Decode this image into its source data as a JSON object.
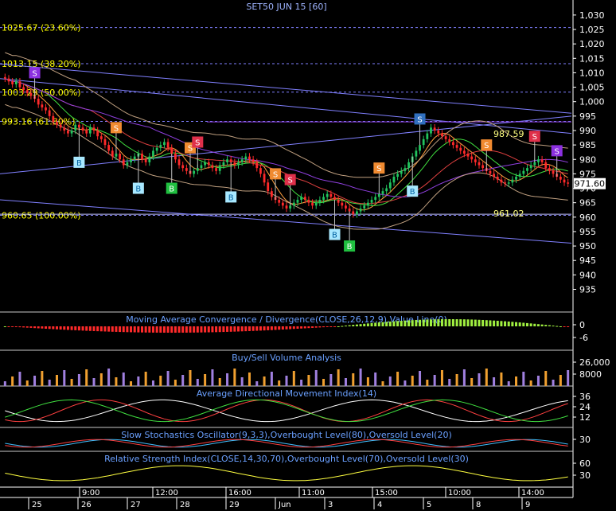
{
  "title": "SET50 JUN 15   [60]",
  "colors": {
    "background": "#000000",
    "bull": "#22c55e",
    "bear": "#ff2a2a",
    "axis_text": "#ffffff",
    "panel_title": "#6aa0ff",
    "fib": "#8080ff",
    "fib_label": "#ffff00",
    "price_box": "#ffffff",
    "sell_orange": "#f08a30",
    "sell_red": "#e0304a",
    "sell_purple": "#8c30e0",
    "buy_cyan": "#a8e8ff",
    "buy_green": "#20c040"
  },
  "price_axis": {
    "ticks": [
      "1,030",
      "1,025",
      "1,020",
      "1,015",
      "1,010",
      "1,005",
      "1,000",
      "995",
      "990",
      "985",
      "980",
      "975",
      "970",
      "965",
      "960",
      "955",
      "950",
      "945",
      "940",
      "935"
    ],
    "current_price": "971.60"
  },
  "fib_levels": [
    {
      "label": "1025.67 (23.60%)",
      "value": 1025.67
    },
    {
      "label": "1013.15 (38.20%)",
      "value": 1013.15
    },
    {
      "label": "1003.29 (50.00%)",
      "value": 1003.29
    },
    {
      "label": "993.16 (61.80%)",
      "value": 993.16
    },
    {
      "label": "960.65 (100.00%)",
      "value": 960.65
    }
  ],
  "annotations": [
    {
      "text": "987.59",
      "value": 987.59
    },
    {
      "text": "961.02",
      "value": 961.02
    }
  ],
  "signals": [
    {
      "type": "S",
      "style": "sell_purple",
      "bar": 8
    },
    {
      "type": "S",
      "style": "sell_orange",
      "bar": 30
    },
    {
      "type": "S",
      "style": "sell_orange",
      "bar": 50
    },
    {
      "type": "S",
      "style": "sell_red",
      "bar": 52
    },
    {
      "type": "S",
      "style": "sell_orange",
      "bar": 73
    },
    {
      "type": "S",
      "style": "sell_red",
      "bar": 77
    },
    {
      "type": "S",
      "style": "sell_orange",
      "bar": 101
    },
    {
      "type": "S",
      "style": "sell_orange",
      "bar": 130
    },
    {
      "type": "S",
      "style": "sell_red",
      "bar": 143
    },
    {
      "type": "S",
      "style": "sell_purple",
      "bar": 149
    },
    {
      "type": "B",
      "style": "buy_cyan",
      "bar": 20
    },
    {
      "type": "B",
      "style": "buy_cyan",
      "bar": 36
    },
    {
      "type": "B",
      "style": "buy_green",
      "bar": 45
    },
    {
      "type": "B",
      "style": "buy_cyan",
      "bar": 61
    },
    {
      "type": "B",
      "style": "buy_cyan",
      "bar": 89
    },
    {
      "type": "B",
      "style": "buy_green",
      "bar": 93
    },
    {
      "type": "B",
      "style": "buy_cyan",
      "bar": 110
    },
    {
      "type": "S",
      "style": "sell_blue",
      "bar": 112
    }
  ],
  "panels": [
    {
      "title": "Moving Average Convergence / Divergence(CLOSE,26,12,9),Value Line(0)",
      "ticks": [
        "0",
        "-6"
      ]
    },
    {
      "title": "Buy/Sell Volume Analysis",
      "ticks": [
        "26,000",
        "8000"
      ]
    },
    {
      "title": "Average Directional Movement Index(14)",
      "ticks": [
        "36",
        "24",
        "12"
      ]
    },
    {
      "title": "Slow Stochastics Oscillator(9,3,3),Overbought Level(80),Oversold Level(20)",
      "ticks": [
        "30"
      ]
    },
    {
      "title": "Relative Strength Index(CLOSE,14,30,70),Overbought Level(70),Oversold Level(30)",
      "ticks": [
        "60",
        "30"
      ]
    }
  ],
  "time_axis": {
    "times": [
      "9:00",
      "12:00",
      "16:00",
      "11:00",
      "15:00",
      "10:00",
      "14:00"
    ],
    "dates": [
      "25",
      "26",
      "27",
      "28",
      "29",
      "Jun",
      "3",
      "4",
      "5",
      "8",
      "9"
    ]
  },
  "chart_data": {
    "type": "candlestick",
    "title": "SET50 JUN 15   [60]",
    "ylim": [
      931,
      1033
    ],
    "close": [
      1008,
      1007,
      1006,
      1007,
      1005,
      1004,
      1003,
      1002,
      1001,
      999,
      998,
      997,
      995,
      993,
      992,
      991,
      990,
      989,
      990,
      992,
      991,
      990,
      989,
      991,
      990,
      988,
      987,
      985,
      983,
      981,
      982,
      980,
      978,
      979,
      980,
      981,
      982,
      980,
      979,
      981,
      983,
      984,
      985,
      986,
      984,
      982,
      980,
      978,
      977,
      976,
      975,
      976,
      977,
      978,
      979,
      978,
      977,
      976,
      978,
      979,
      980,
      979,
      978,
      979,
      980,
      981,
      980,
      979,
      977,
      975,
      972,
      969,
      967,
      966,
      965,
      964,
      963,
      964,
      965,
      966,
      967,
      966,
      965,
      964,
      965,
      966,
      967,
      968,
      967,
      966,
      965,
      964,
      963,
      962,
      961,
      962,
      963,
      964,
      965,
      966,
      967,
      968,
      969,
      970,
      972,
      974,
      975,
      976,
      977,
      979,
      981,
      983,
      985,
      987,
      989,
      991,
      990,
      989,
      988,
      987,
      986,
      985,
      984,
      983,
      982,
      981,
      980,
      979,
      978,
      977,
      976,
      975,
      974,
      973,
      972,
      971.6,
      972,
      973,
      974,
      975,
      976,
      977,
      978,
      979,
      980,
      979,
      977,
      976,
      975,
      974,
      973,
      972,
      971.6
    ]
  }
}
